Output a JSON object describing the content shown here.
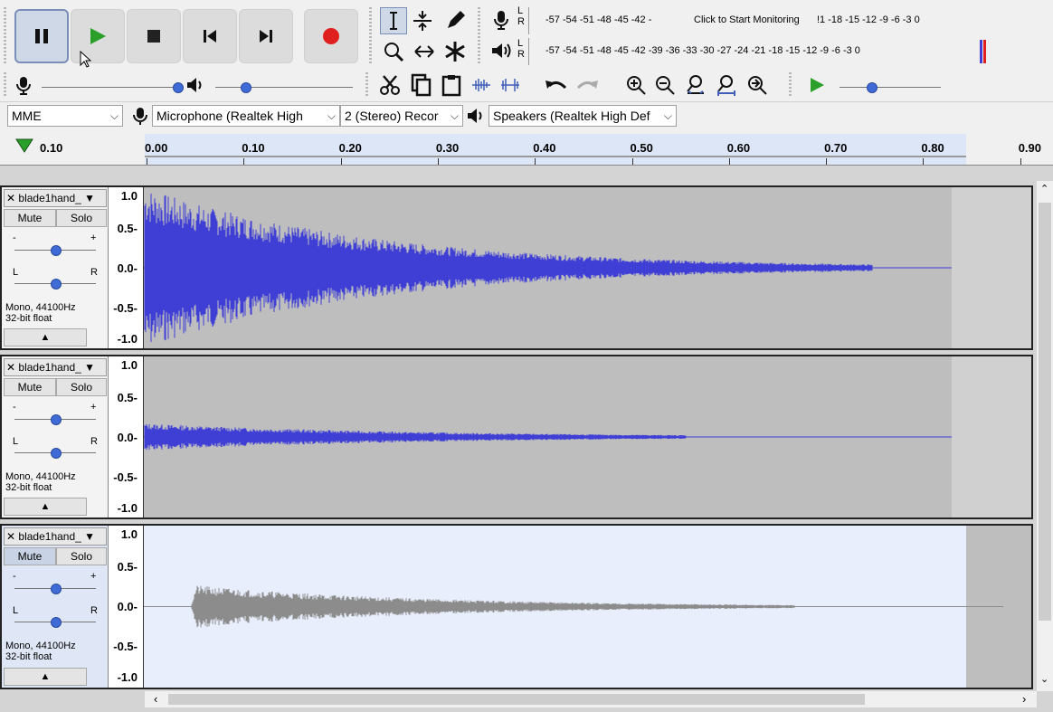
{
  "transport": {
    "buttons": [
      "pause-icon",
      "play-icon",
      "stop-icon",
      "skip-start-icon",
      "skip-end-icon",
      "record-icon"
    ]
  },
  "meters": {
    "rec_scale": "-57 -54 -51 -48 -45 -42 -",
    "rec_click": "Click to Start Monitoring",
    "rec_scale_end": "!1 -18 -15 -12  -9  -6  -3  0",
    "play_scale": "-57 -54 -51 -48 -45 -42 -39 -36 -33 -30 -27 -24 -21 -18 -15 -12  -9  -6  -3  0",
    "l": "L",
    "r": "R"
  },
  "device": {
    "host": "MME",
    "mic": "Microphone (Realtek High",
    "channels": "2 (Stereo) Recor",
    "speakers": "Speakers (Realtek High Def"
  },
  "timeline": {
    "left_value": "0.10",
    "ticks": [
      "0.00",
      "0.10",
      "0.20",
      "0.30",
      "0.40",
      "0.50",
      "0.60",
      "0.70",
      "0.80",
      "0.90"
    ]
  },
  "tracks": [
    {
      "name": "blade1hand_",
      "mute": "Mute",
      "solo": "Solo",
      "info1": "Mono, 44100Hz",
      "info2": "32-bit float",
      "gain_minus": "-",
      "gain_plus": "+",
      "pan_l": "L",
      "pan_r": "R"
    },
    {
      "name": "blade1hand_",
      "mute": "Mute",
      "solo": "Solo",
      "info1": "Mono, 44100Hz",
      "info2": "32-bit float",
      "gain_minus": "-",
      "gain_plus": "+",
      "pan_l": "L",
      "pan_r": "R"
    },
    {
      "name": "blade1hand_",
      "mute": "Mute",
      "solo": "Solo",
      "info1": "Mono, 44100Hz",
      "info2": "32-bit float",
      "gain_minus": "-",
      "gain_plus": "+",
      "pan_l": "L",
      "pan_r": "R"
    }
  ],
  "vruler": [
    "1.0",
    "0.5-",
    "0.0-",
    "-0.5-",
    "-1.0"
  ],
  "colors": {
    "wave": "#3f3fd6",
    "wave_bg": "#bebebe",
    "wave_selected_bg": "#e8eefb",
    "wave_gray": "#8c8c8c"
  }
}
